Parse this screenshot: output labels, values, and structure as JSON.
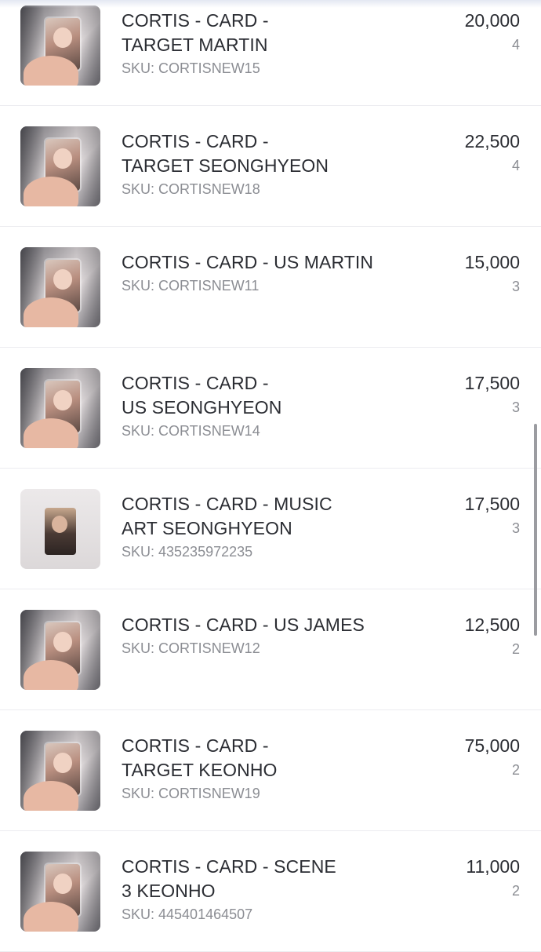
{
  "products": [
    {
      "title_line1": "CORTIS - CARD -",
      "title_line2": "TARGET MARTIN",
      "sku": "SKU: CORTISNEW15",
      "price": "20,000",
      "qty": "4"
    },
    {
      "title_line1": "CORTIS - CARD -",
      "title_line2": "TARGET SEONGHYEON",
      "sku": "SKU: CORTISNEW18",
      "price": "22,500",
      "qty": "4"
    },
    {
      "title_line1": "CORTIS - CARD - US MARTIN",
      "title_line2": "",
      "sku": "SKU: CORTISNEW11",
      "price": "15,000",
      "qty": "3"
    },
    {
      "title_line1": "CORTIS - CARD -",
      "title_line2": "US SEONGHYEON",
      "sku": "SKU: CORTISNEW14",
      "price": "17,500",
      "qty": "3"
    },
    {
      "title_line1": "CORTIS - CARD - MUSIC",
      "title_line2": "ART SEONGHYEON",
      "sku": "SKU: 435235972235",
      "price": "17,500",
      "qty": "3"
    },
    {
      "title_line1": "CORTIS - CARD - US JAMES",
      "title_line2": "",
      "sku": "SKU: CORTISNEW12",
      "price": "12,500",
      "qty": "2"
    },
    {
      "title_line1": "CORTIS - CARD -",
      "title_line2": "TARGET KEONHO",
      "sku": "SKU: CORTISNEW19",
      "price": "75,000",
      "qty": "2"
    },
    {
      "title_line1": "CORTIS - CARD - SCENE",
      "title_line2": "3 KEONHO",
      "sku": "SKU: 445401464507",
      "price": "11,000",
      "qty": "2"
    }
  ]
}
